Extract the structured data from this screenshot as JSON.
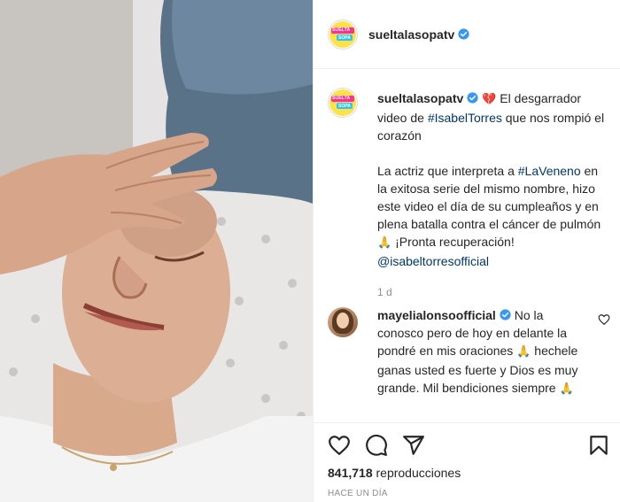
{
  "post": {
    "author": {
      "username": "sueltalasopatv",
      "avatar_text_1": "SUELTA",
      "avatar_text_2": "SOPA"
    },
    "caption": {
      "username": "sueltalasopatv",
      "emoji_1": "💔",
      "text_1a": " El desgarrador video de ",
      "tag_1": "#IsabelTorres",
      "text_1b": " que nos rompió el corazón",
      "text_2a": "La actriz que interpreta a ",
      "tag_2": "#LaVeneno",
      "text_2b": " en la exitosa serie del mismo nombre, hizo este video el día de su cumpleaños y en plena batalla contra el cáncer de pulmón ",
      "emoji_2": "🙏",
      "text_2c": " ¡Pronta recuperación! ",
      "mention": "@isabeltorresofficial",
      "time": "1 d"
    },
    "comment": {
      "username": "mayelialonsoofficial",
      "text_a": " No la conosco pero de hoy en delante la pondré en mis oraciones ",
      "emoji_a": "🙏",
      "text_b": " hechele ganas usted es fuerte y Dios es muy grande. Mil bendiciones siempre ",
      "emoji_b": "🙏"
    },
    "stats": {
      "views_count": "841,718",
      "views_label": " reproducciones",
      "posted_ago": "HACE UN DÍA"
    },
    "icons": {
      "like": "heart-icon",
      "comment": "comment-icon",
      "share": "share-icon",
      "save": "bookmark-icon",
      "verified": "verified-badge-icon",
      "comment_like": "heart-outline-icon"
    },
    "colors": {
      "verified_blue": "#3897f0",
      "link_blue": "#00376b",
      "muted": "#8e8e8e",
      "text": "#262626"
    }
  }
}
